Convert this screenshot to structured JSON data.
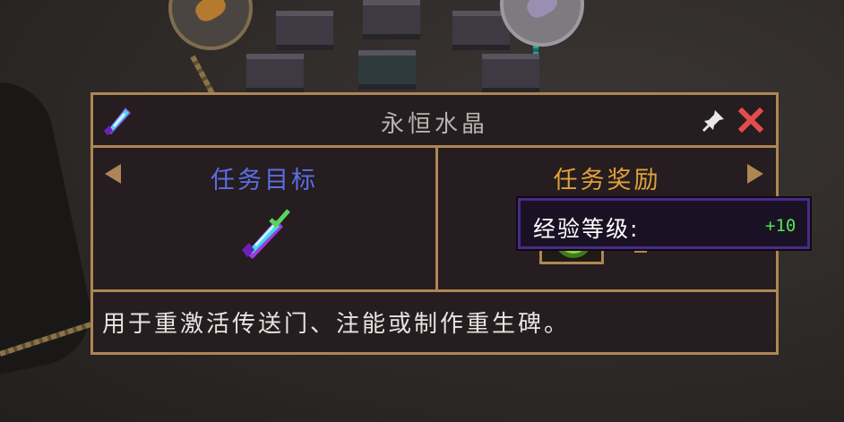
{
  "quest": {
    "title": "永恒水晶",
    "goal_label": "任务目标",
    "reward_label": "任务奖励",
    "description": "用于重激活传送门、注能或制作重生碑。"
  },
  "tooltip": {
    "label": "经验等级:",
    "value": "+10"
  },
  "icons": {
    "title": "eternal-crystal-icon",
    "pin": "pin-icon",
    "close": "close-icon",
    "goal": "eternal-crystal-icon",
    "reward": "experience-bottle-icon"
  },
  "colors": {
    "frame": "#ae8655",
    "panel_bg": "#251d1f",
    "goal_title": "#5b6ee6",
    "reward_title": "#e0a13a",
    "close": "#e24c4c",
    "tooltip_value": "#50e650"
  }
}
